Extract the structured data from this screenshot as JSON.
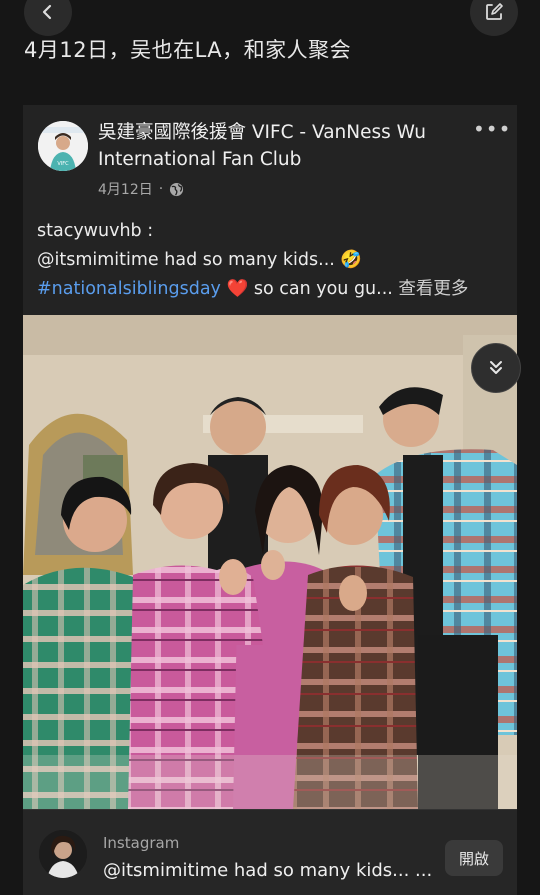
{
  "nav": {
    "back_icon": "chevron-left-icon",
    "edit_icon": "edit-icon"
  },
  "headline": "4月12日，吴也在LA，和家人聚会",
  "post": {
    "page_name_line1": "吳建豪國際後援會 VIFC - VanNess Wu",
    "page_name_line2": "International Fan Club",
    "more_label": "•••",
    "date": "4月12日",
    "separator": "·",
    "audience_icon": "globe-icon",
    "text": {
      "line1": "stacywuvhb :",
      "line2_prefix": "@itsmimitime had so many kids... ",
      "line2_emoji": "🤣",
      "line3_hashtag": "#nationalsiblingsday",
      "line3_emoji": "❤️",
      "line3_rest": " so can you gu... ",
      "see_more": "查看更多"
    },
    "photo_icon": "group-photo",
    "collapse_icon": "chevrons-down-icon"
  },
  "instagram_bar": {
    "source": "Instagram",
    "caption": "@itsmimitime had so many kids... ...",
    "open_label": "開啟"
  },
  "colors": {
    "background": "#161616",
    "card": "#232323",
    "hashtag": "#5a9ded"
  }
}
